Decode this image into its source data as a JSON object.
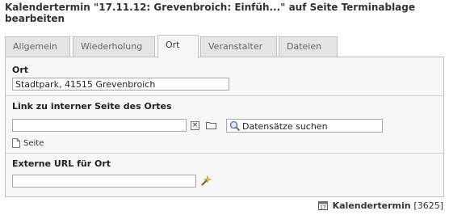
{
  "header": {
    "title": "Kalendertermin \"17.11.12: Grevenbroich: Einfüh...\" auf Seite Terminablage bearbeiten"
  },
  "tabs": [
    {
      "label": "Allgemein",
      "active": false
    },
    {
      "label": "Wiederholung",
      "active": false
    },
    {
      "label": "Ort",
      "active": true
    },
    {
      "label": "Veranstalter",
      "active": false
    },
    {
      "label": "Dateien",
      "active": false
    }
  ],
  "form": {
    "ort": {
      "label": "Ort",
      "value": "Stadtpark, 41515 Grevenbroich"
    },
    "link": {
      "label": "Link zu interner Seite des Ortes",
      "value": "",
      "search_placeholder": "Datensätze suchen",
      "page_label": "Seite"
    },
    "external_url": {
      "label": "Externe URL für Ort",
      "value": ""
    }
  },
  "footer": {
    "record_type": "Kalendertermin",
    "record_id": "[3625]"
  },
  "icons": {
    "clear": "close-icon",
    "browse": "folder-icon",
    "search": "magnifier-icon",
    "page": "page-icon",
    "link_wizard": "link-wizard-icon",
    "record": "calendar-icon"
  },
  "colors": {
    "panel_bg": "#f7f7f7",
    "tab_bg": "#e4e4e4",
    "border": "#c0c0c0"
  }
}
